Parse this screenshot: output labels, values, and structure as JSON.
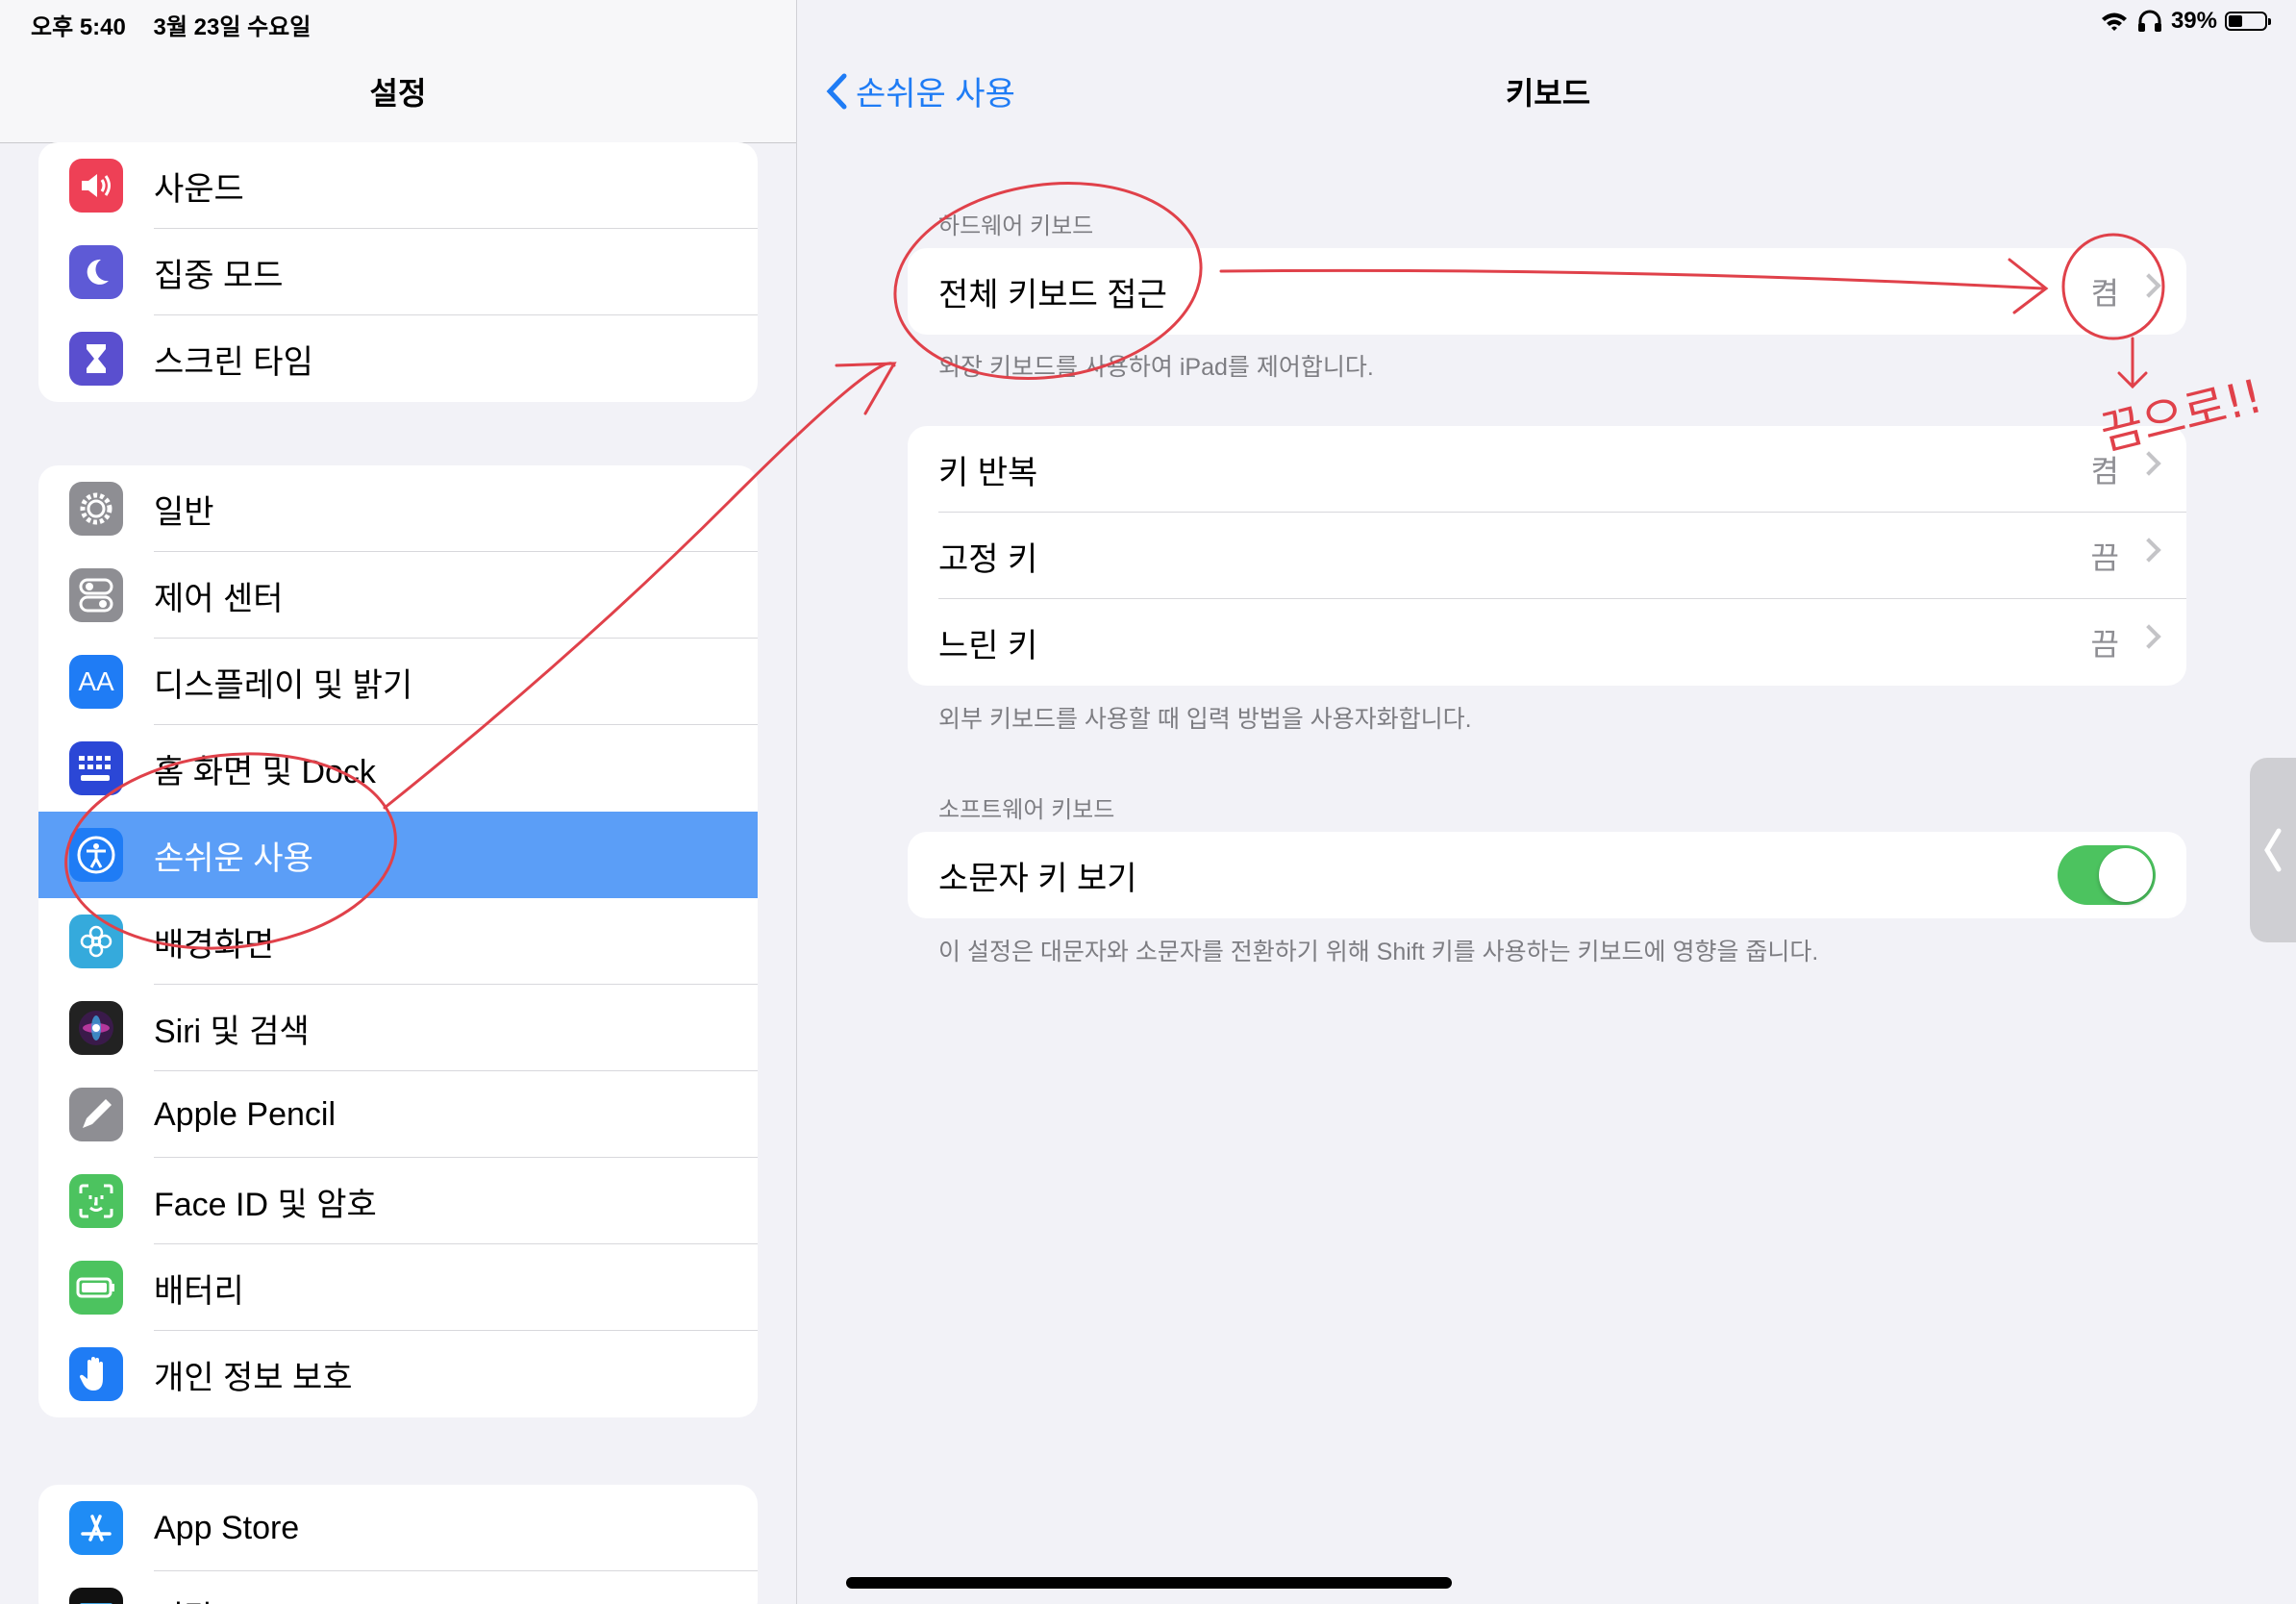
{
  "status": {
    "time": "오후 5:40",
    "date": "3월 23일 수요일",
    "battery": "39%",
    "battery_level": 0.39
  },
  "sidebar": {
    "title": "설정",
    "groups": [
      [
        {
          "label": "사운드",
          "icon": "speaker-icon",
          "color": "#ee4056"
        },
        {
          "label": "집중 모드",
          "icon": "moon-icon",
          "color": "#5e5ad6"
        },
        {
          "label": "스크린 타임",
          "icon": "hourglass-icon",
          "color": "#5a4fcf"
        }
      ],
      [
        {
          "label": "일반",
          "icon": "gear-icon",
          "color": "#8e8e93"
        },
        {
          "label": "제어 센터",
          "icon": "switches-icon",
          "color": "#8e8e93"
        },
        {
          "label": "디스플레이 및 밝기",
          "icon": "aa-icon",
          "color": "#1f7cf5"
        },
        {
          "label": "홈 화면 및 Dock",
          "icon": "grid-icon",
          "color": "#2b47d6"
        },
        {
          "label": "손쉬운 사용",
          "icon": "accessibility-icon",
          "color": "#1f7cf5"
        },
        {
          "label": "배경화면",
          "icon": "flower-icon",
          "color": "#35aadc"
        },
        {
          "label": "Siri 및 검색",
          "icon": "siri-icon",
          "color": "#222222"
        },
        {
          "label": "Apple Pencil",
          "icon": "pencil-icon",
          "color": "#8e8e93"
        },
        {
          "label": "Face ID 및 암호",
          "icon": "faceid-icon",
          "color": "#4cc35f"
        },
        {
          "label": "배터리",
          "icon": "battery-icon",
          "color": "#4cc35f"
        },
        {
          "label": "개인 정보 보호",
          "icon": "hand-icon",
          "color": "#1f7cf5"
        }
      ],
      [
        {
          "label": "App Store",
          "icon": "appstore-icon",
          "color": "#1f8cf5"
        },
        {
          "label": "지갑",
          "icon": "wallet-icon",
          "color": "#111111"
        }
      ]
    ],
    "selected": "손쉬운 사용"
  },
  "detail": {
    "back_label": "손쉬운 사용",
    "title": "키보드",
    "hardware": {
      "header": "하드웨어 키보드",
      "row": {
        "label": "전체 키보드 접근",
        "value": "켬"
      },
      "footer": "외장 키보드를 사용하여 iPad를 제어합니다."
    },
    "keys": {
      "rows": [
        {
          "label": "키 반복",
          "value": "켬"
        },
        {
          "label": "고정 키",
          "value": "끔"
        },
        {
          "label": "느린 키",
          "value": "끔"
        }
      ],
      "footer": "외부 키보드를 사용할 때 입력 방법을 사용자화합니다."
    },
    "software": {
      "header": "소프트웨어 키보드",
      "row": {
        "label": "소문자 키 보기",
        "on": true
      },
      "footer": "이 설정은 대문자와 소문자를 전환하기 위해 Shift 키를 사용하는 키보드에 영향을 줍니다."
    }
  },
  "annotation": {
    "note": "끔으로!!",
    "color": "#e0414a"
  }
}
